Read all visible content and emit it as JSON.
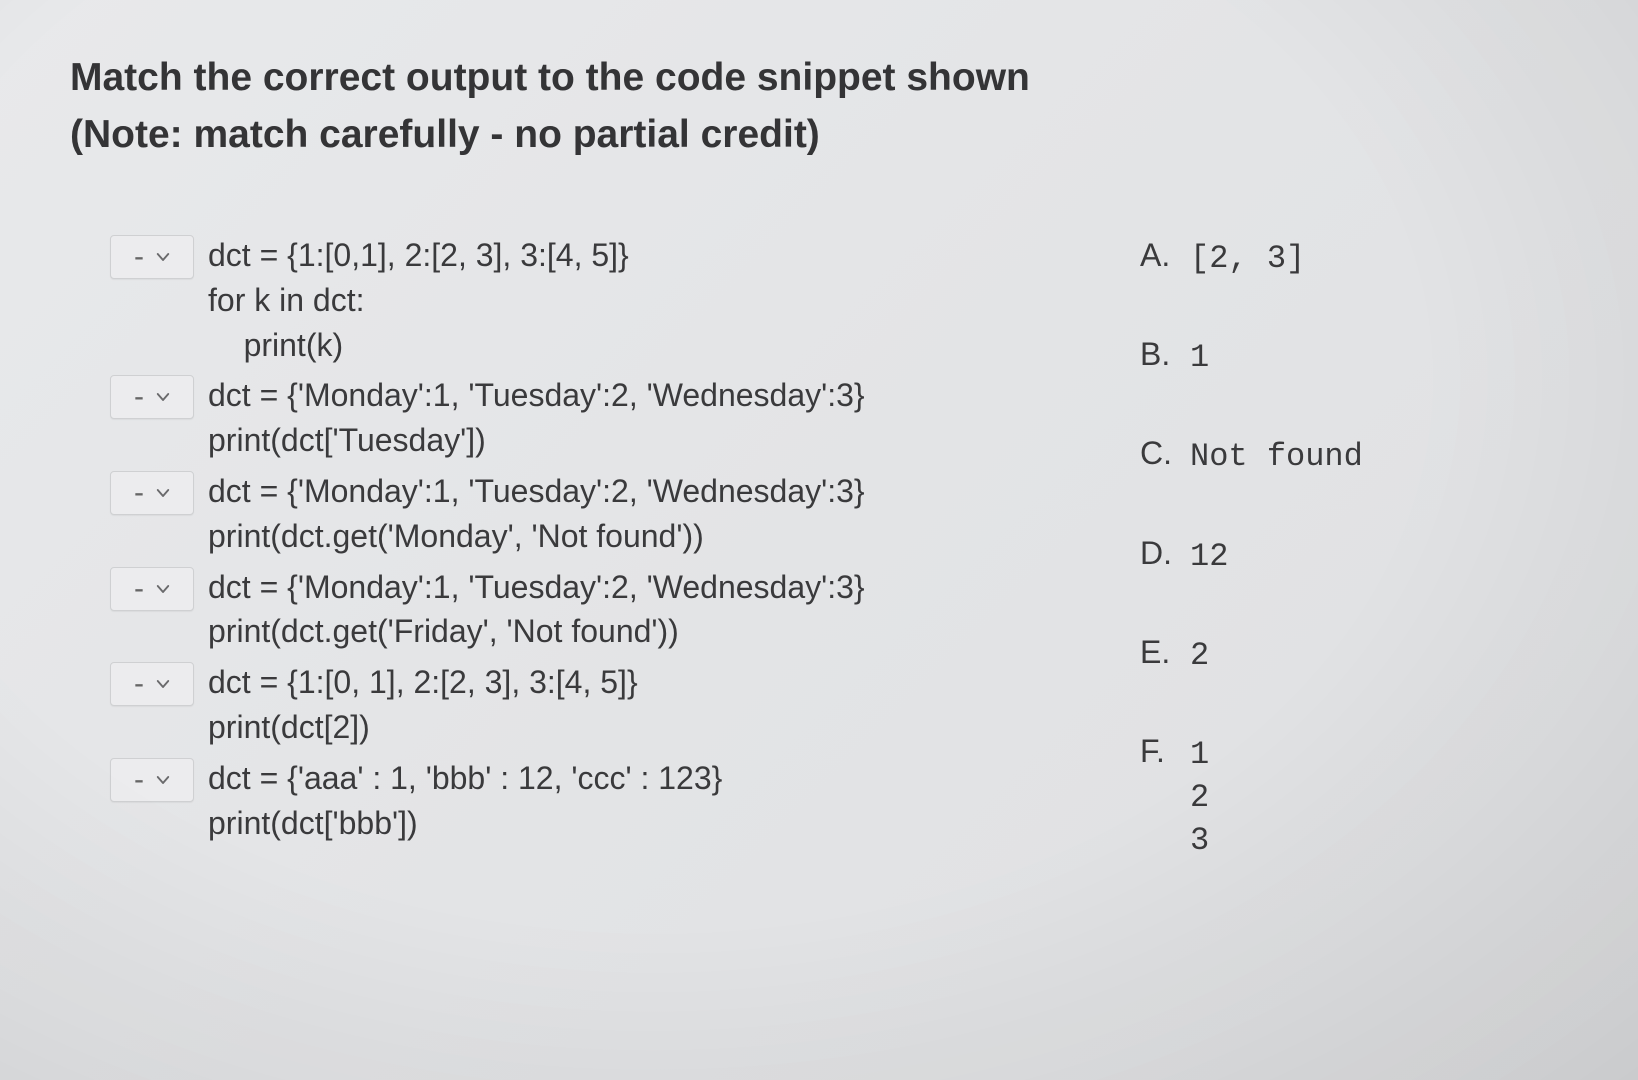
{
  "title": {
    "line1": "Match the correct output to the code snippet shown",
    "line2": "(Note: match carefully - no partial credit)"
  },
  "dropdown_placeholder": "-",
  "questions": [
    {
      "code": "dct = {1:[0,1], 2:[2, 3], 3:[4, 5]}\nfor k in dct:\n    print(k)"
    },
    {
      "code": "dct = {'Monday':1, 'Tuesday':2, 'Wednesday':3}\nprint(dct['Tuesday'])"
    },
    {
      "code": "dct = {'Monday':1, 'Tuesday':2, 'Wednesday':3}\nprint(dct.get('Monday', 'Not found'))"
    },
    {
      "code": "dct = {'Monday':1, 'Tuesday':2, 'Wednesday':3}\nprint(dct.get('Friday', 'Not found'))"
    },
    {
      "code": "dct = {1:[0, 1], 2:[2, 3], 3:[4, 5]}\nprint(dct[2])"
    },
    {
      "code": "dct = {'aaa' : 1, 'bbb' : 12, 'ccc' : 123}\nprint(dct['bbb'])"
    }
  ],
  "answers": [
    {
      "letter": "A.",
      "text": "[2, 3]",
      "mono": true
    },
    {
      "letter": "B.",
      "text": "1",
      "mono": true
    },
    {
      "letter": "C.",
      "text": "Not found",
      "mono": true
    },
    {
      "letter": "D.",
      "text": "12",
      "mono": true
    },
    {
      "letter": "E.",
      "text": "2",
      "mono": true
    },
    {
      "letter": "F.",
      "text": "1\n2\n3",
      "mono": true
    }
  ]
}
